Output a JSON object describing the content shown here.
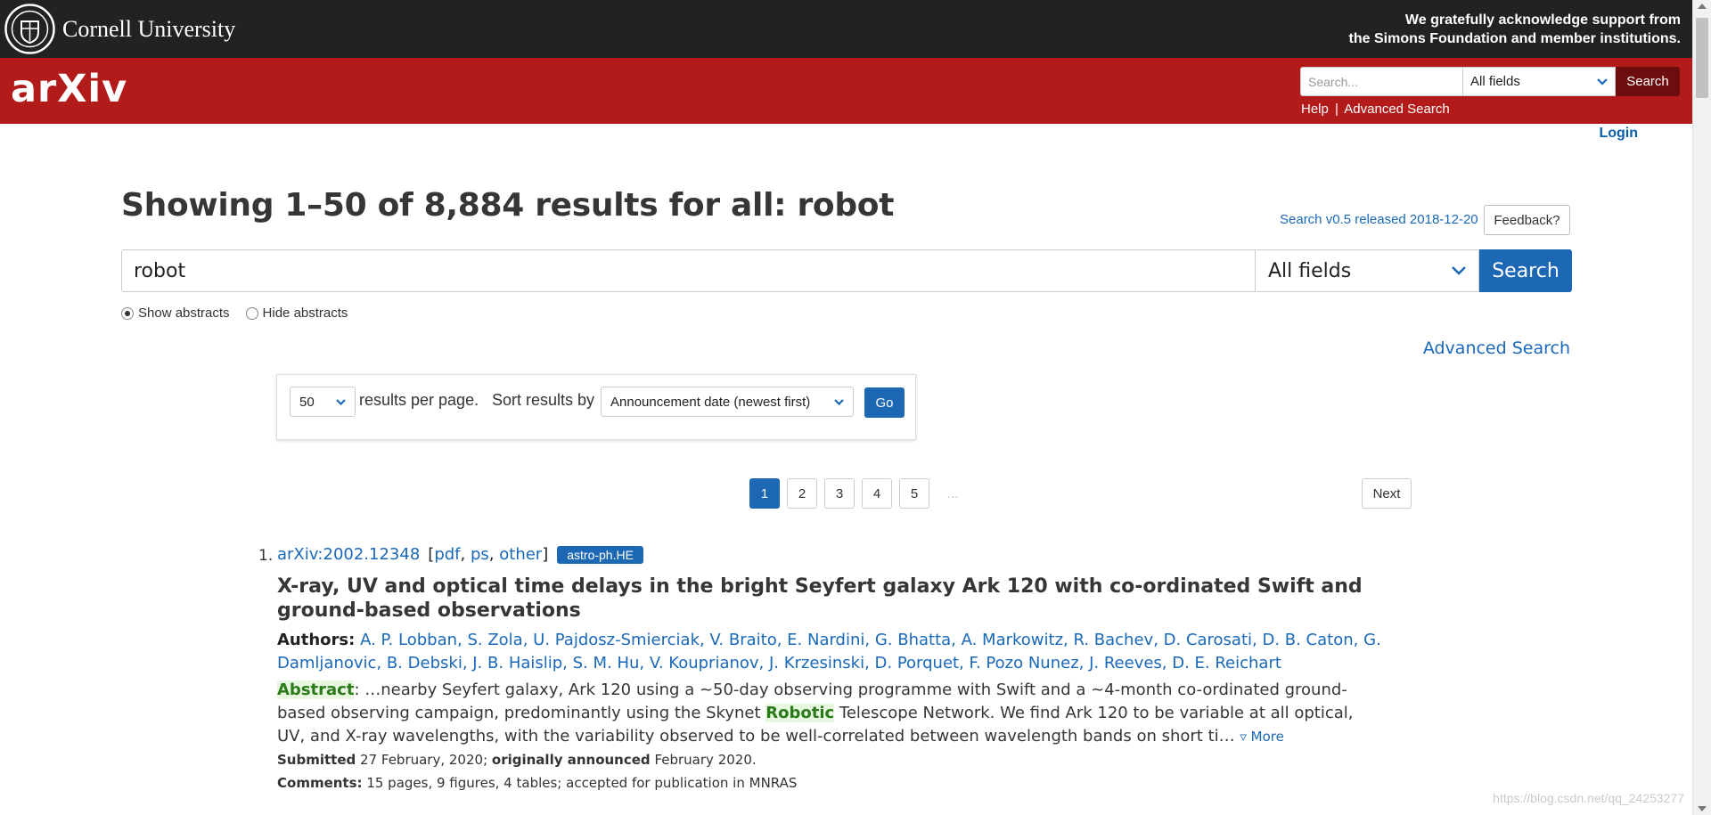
{
  "cornell": {
    "name": "Cornell University",
    "ack_line1": "We gratefully acknowledge support from",
    "ack_line2": "the Simons Foundation and member institutions."
  },
  "header": {
    "logo": "arXiv",
    "search_placeholder": "Search...",
    "field_select": "All fields",
    "search_button": "Search",
    "help": "Help",
    "separator": "|",
    "advanced": "Advanced Search"
  },
  "login": "Login",
  "page": {
    "title": "Showing 1–50 of 8,884 results for all: robot",
    "version": "Search v0.5 released 2018-12-20",
    "feedback": "Feedback?"
  },
  "search": {
    "query": "robot",
    "field": "All fields",
    "button": "Search",
    "show_abstracts": "Show abstracts",
    "hide_abstracts": "Hide abstracts",
    "advanced": "Advanced Search"
  },
  "sort": {
    "per_page": "50",
    "per_page_label": "results per page.",
    "sort_label": "Sort results by",
    "sort_value": "Announcement date (newest first)",
    "go": "Go"
  },
  "pagination": {
    "pages": [
      "1",
      "2",
      "3",
      "4",
      "5"
    ],
    "ellipsis": "…",
    "next": "Next"
  },
  "results": [
    {
      "num": "1.",
      "id": "arXiv:2002.12348",
      "formats": [
        "pdf",
        "ps",
        "other"
      ],
      "category": "astro-ph.HE",
      "title": "X-ray, UV and optical time delays in the bright Seyfert galaxy Ark 120 with co-ordinated Swift and ground-based observations",
      "authors_label": "Authors:",
      "authors": "A. P. Lobban, S. Zola, U. Pajdosz-Smierciak, V. Braito, E. Nardini, G. Bhatta, A. Markowitz, R. Bachev, D. Carosati, D. B. Caton, G. Damljanovic, B. Debski, J. B. Haislip, S. M. Hu, V. Kouprianov, J. Krzesinski, D. Porquet, F. Pozo Nunez, J. Reeves, D. E. Reichart",
      "abstract_label": "Abstract",
      "abstract_pre": ": …nearby Seyfert galaxy, Ark 120 using a ~50-day observing programme with Swift and a ~4-month co-ordinated ground-based observing campaign, predominantly using the Skynet ",
      "abstract_hl": "Robotic",
      "abstract_post": " Telescope Network. We find Ark 120 to be variable at all optical, UV, and X-ray wavelengths, with the variability observed to be well-correlated between wavelength bands on short ti…",
      "more": "▿ More",
      "submitted_label": "Submitted",
      "submitted": "27 February, 2020;",
      "announced_label": "originally announced",
      "announced": "February 2020.",
      "comments_label": "Comments:",
      "comments": "15 pages, 9 figures, 4 tables; accepted for publication in MNRAS"
    }
  ],
  "watermark": "https://blog.csdn.net/qq_24253277",
  "colors": {
    "cornell_bar": "#222222",
    "arxiv_red": "#b31b1b",
    "link_blue": "#1a68b8",
    "button_blue": "#1d68b4"
  }
}
